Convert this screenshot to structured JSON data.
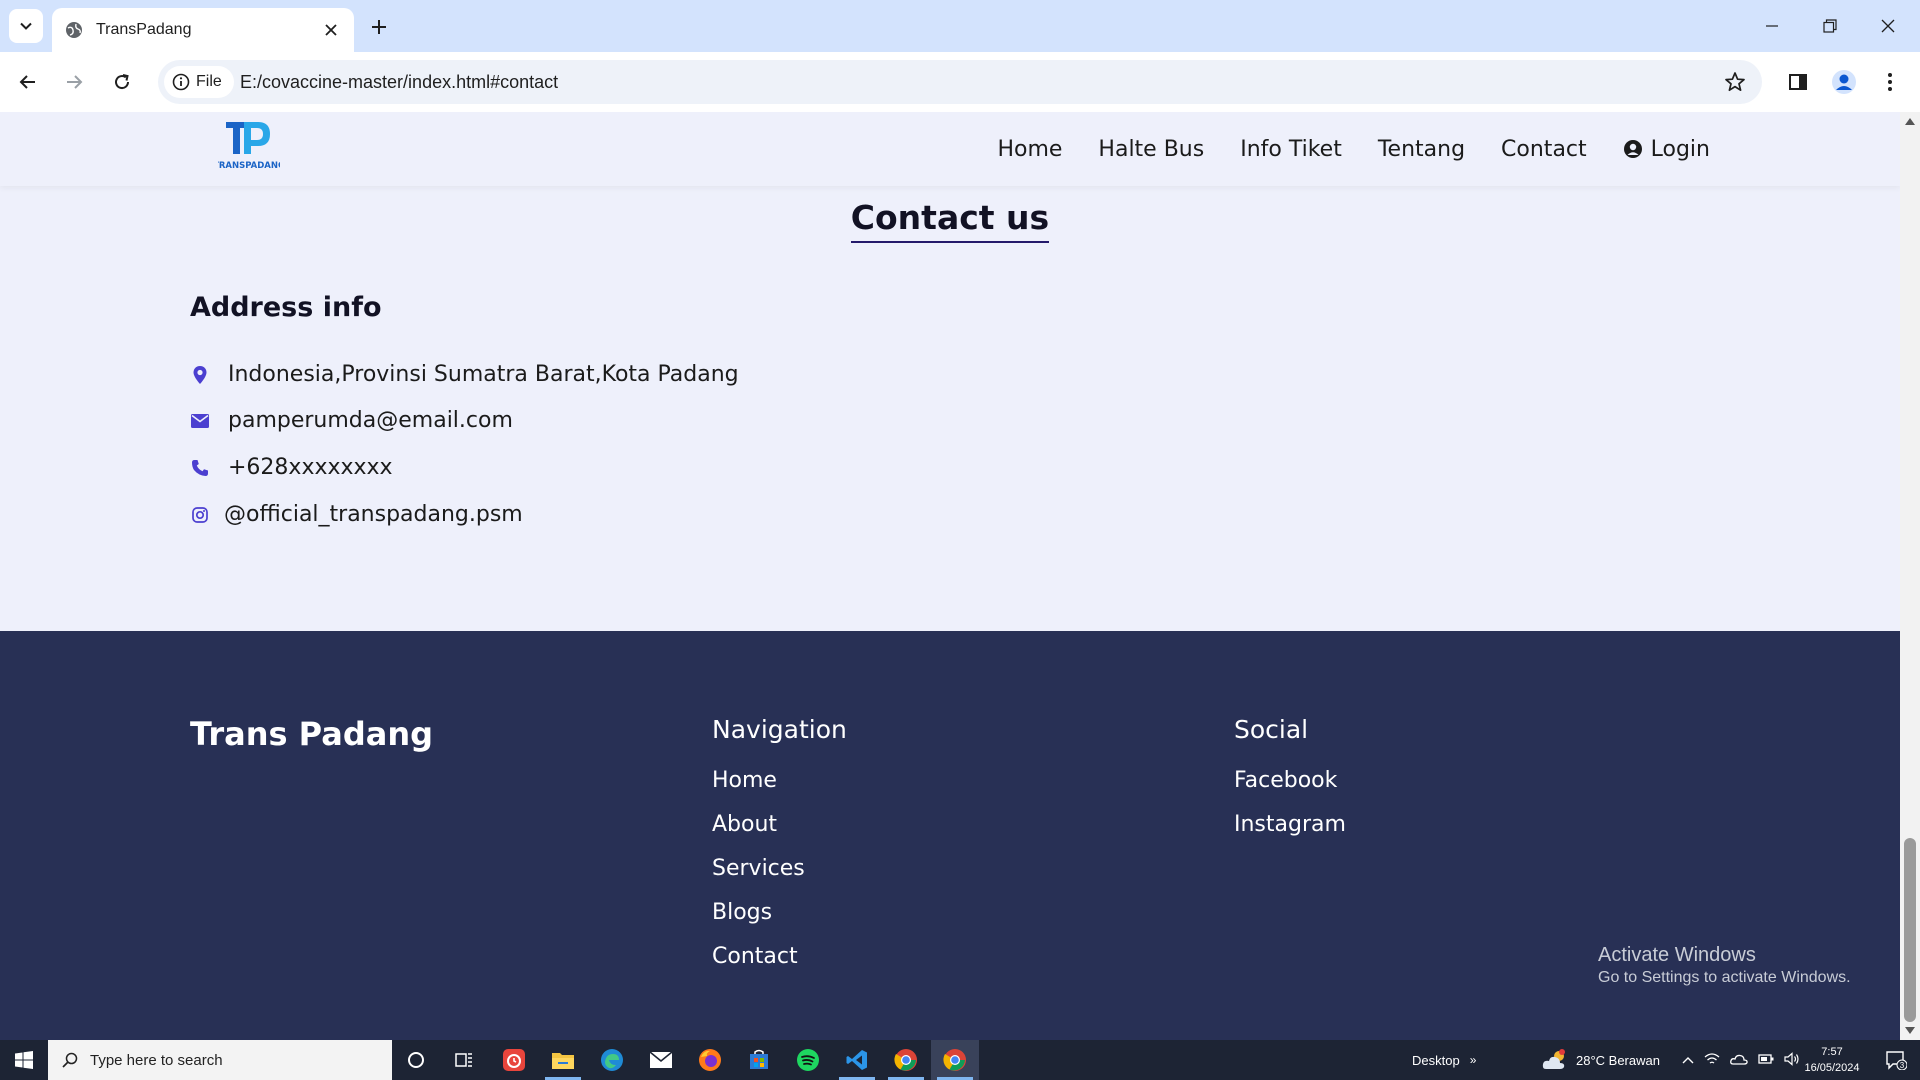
{
  "browser": {
    "tab_title": "TransPadang",
    "file_chip": "File",
    "url": "E:/covaccine-master/index.html#contact"
  },
  "site": {
    "logo_text": "TRANSPADANG",
    "nav": [
      "Home",
      "Halte Bus",
      "Info Tiket",
      "Tentang",
      "Contact"
    ],
    "login_label": "Login"
  },
  "contact": {
    "title": "Contact us",
    "address_heading": "Address info",
    "address": "Indonesia,Provinsi Sumatra Barat,Kota Padang",
    "email": "pamperumda@email.com",
    "phone": "+628xxxxxxxx",
    "instagram": "@official_transpadang.psm",
    "icon_color": "#4b3fd0"
  },
  "footer": {
    "brand": "Trans Padang",
    "navigation_heading": "Navigation",
    "navigation_links": [
      "Home",
      "About",
      "Services",
      "Blogs",
      "Contact"
    ],
    "social_heading": "Social",
    "social_links": [
      "Facebook",
      "Instagram"
    ],
    "background": "#283055"
  },
  "watermark": {
    "line1": "Activate Windows",
    "line2": "Go to Settings to activate Windows."
  },
  "taskbar": {
    "search_placeholder": "Type here to search",
    "desktop_label": "Desktop",
    "weather": "28°C  Berawan",
    "time": "7:57",
    "date": "16/05/2024",
    "notification_count": "3"
  }
}
